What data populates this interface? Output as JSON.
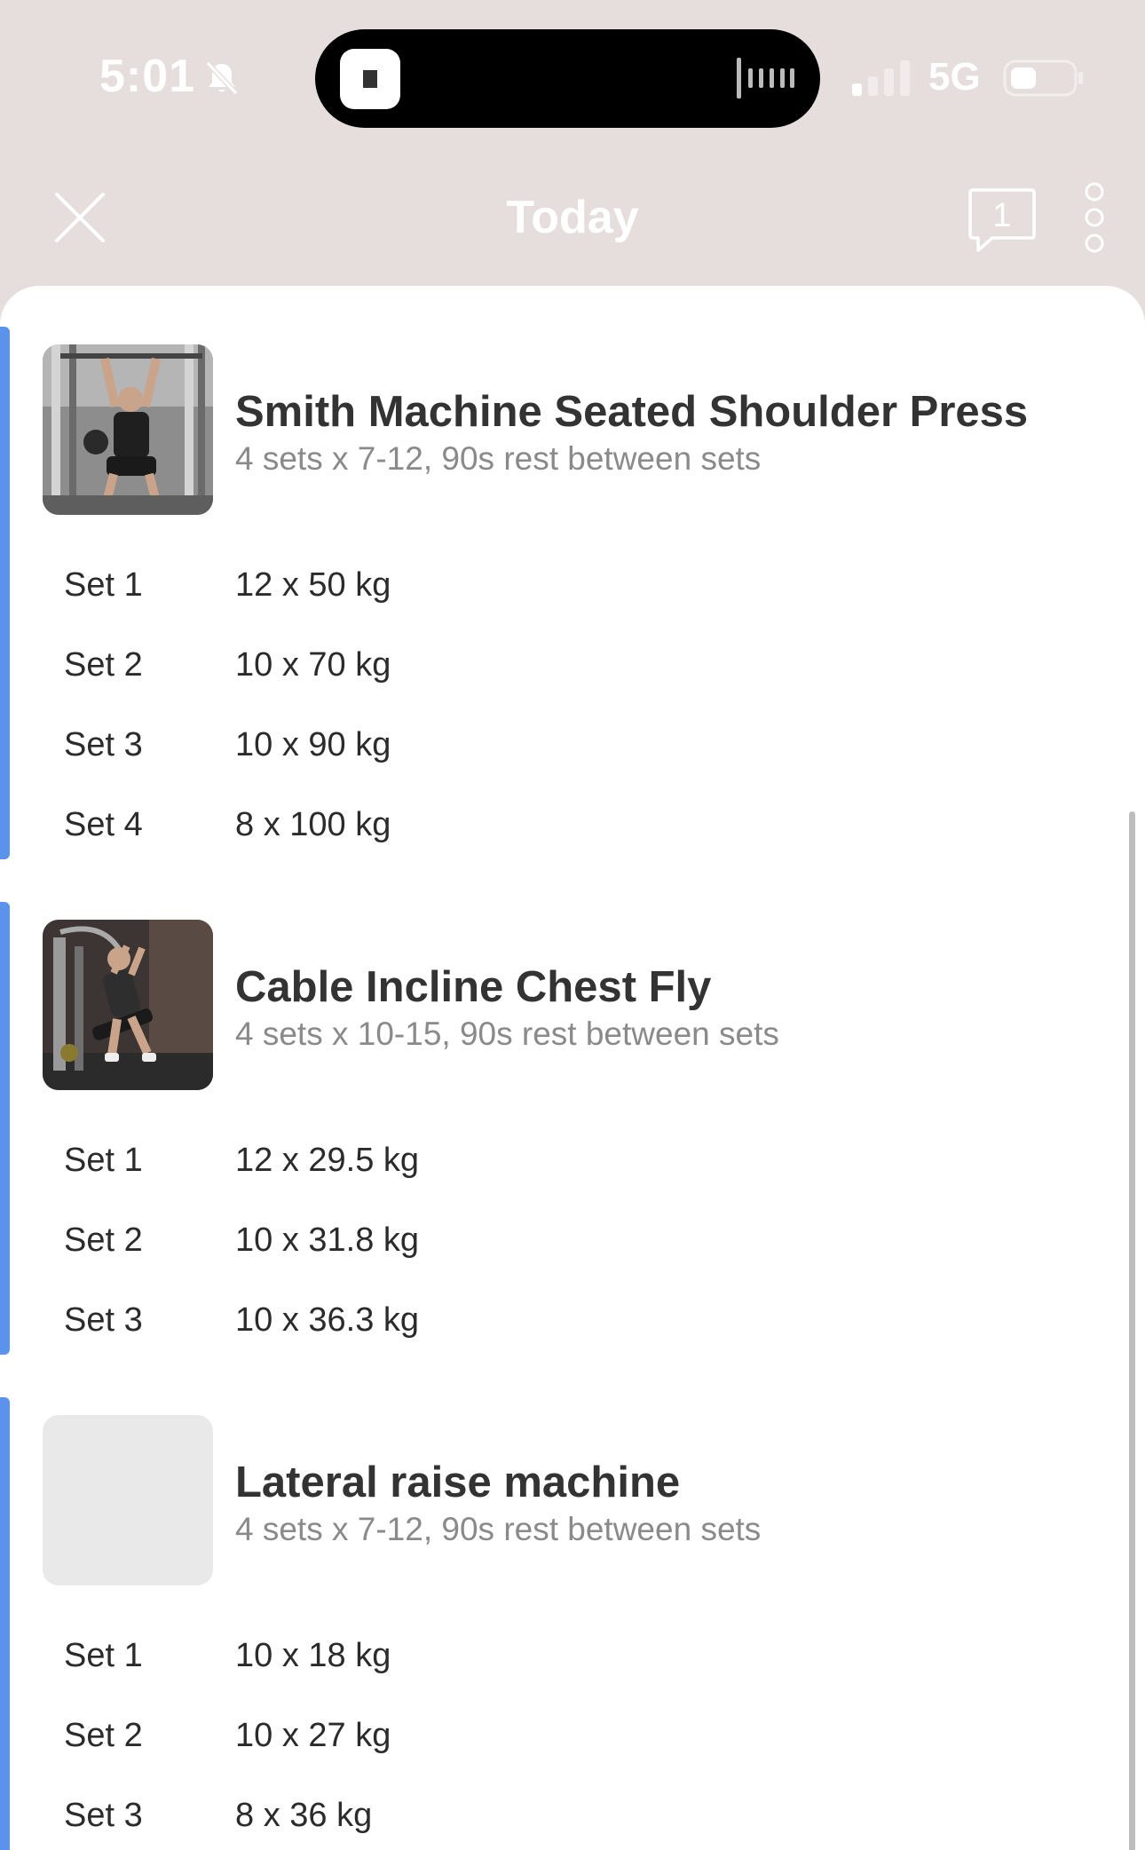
{
  "status_bar": {
    "time": "5:01",
    "network": "5G"
  },
  "header": {
    "title": "Today",
    "comment_count": "1"
  },
  "exercises": [
    {
      "name": "Smith Machine Seated Shoulder Press",
      "description": "4 sets x 7-12, 90s rest between sets",
      "sets": [
        {
          "label": "Set 1",
          "value": "12 x 50 kg"
        },
        {
          "label": "Set 2",
          "value": "10 x 70 kg"
        },
        {
          "label": "Set 3",
          "value": "10 x 90 kg"
        },
        {
          "label": "Set 4",
          "value": "8 x 100 kg"
        }
      ]
    },
    {
      "name": "Cable Incline Chest Fly",
      "description": "4 sets x 10-15, 90s rest between sets",
      "sets": [
        {
          "label": "Set 1",
          "value": "12 x 29.5 kg"
        },
        {
          "label": "Set 2",
          "value": "10 x 31.8 kg"
        },
        {
          "label": "Set 3",
          "value": "10 x 36.3 kg"
        }
      ]
    },
    {
      "name": "Lateral raise machine",
      "description": "4 sets x 7-12, 90s rest between sets",
      "sets": [
        {
          "label": "Set 1",
          "value": "10 x 18 kg"
        },
        {
          "label": "Set 2",
          "value": "10 x 27 kg"
        },
        {
          "label": "Set 3",
          "value": "8 x 36 kg"
        }
      ]
    }
  ],
  "colors": {
    "header_bg": "#e6dedd",
    "accent_bar": "#5b93ec",
    "title_text": "#333333",
    "secondary_text": "#8a8a8a"
  }
}
